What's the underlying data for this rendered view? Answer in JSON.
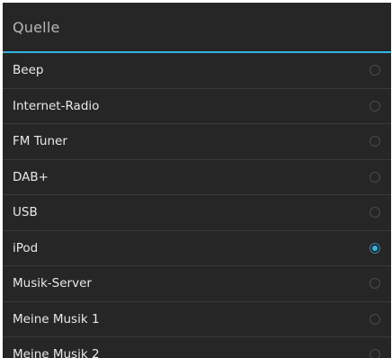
{
  "dialog": {
    "title": "Quelle",
    "accent_color": "#33b5e5",
    "selected_index": 5,
    "options": [
      {
        "label": "Beep",
        "selected": false
      },
      {
        "label": "Internet-Radio",
        "selected": false
      },
      {
        "label": "FM Tuner",
        "selected": false
      },
      {
        "label": "DAB+",
        "selected": false
      },
      {
        "label": "USB",
        "selected": false
      },
      {
        "label": "iPod",
        "selected": true
      },
      {
        "label": "Musik-Server",
        "selected": false
      },
      {
        "label": "Meine Musik 1",
        "selected": false
      },
      {
        "label": "Meine Musik 2",
        "selected": false
      }
    ]
  }
}
